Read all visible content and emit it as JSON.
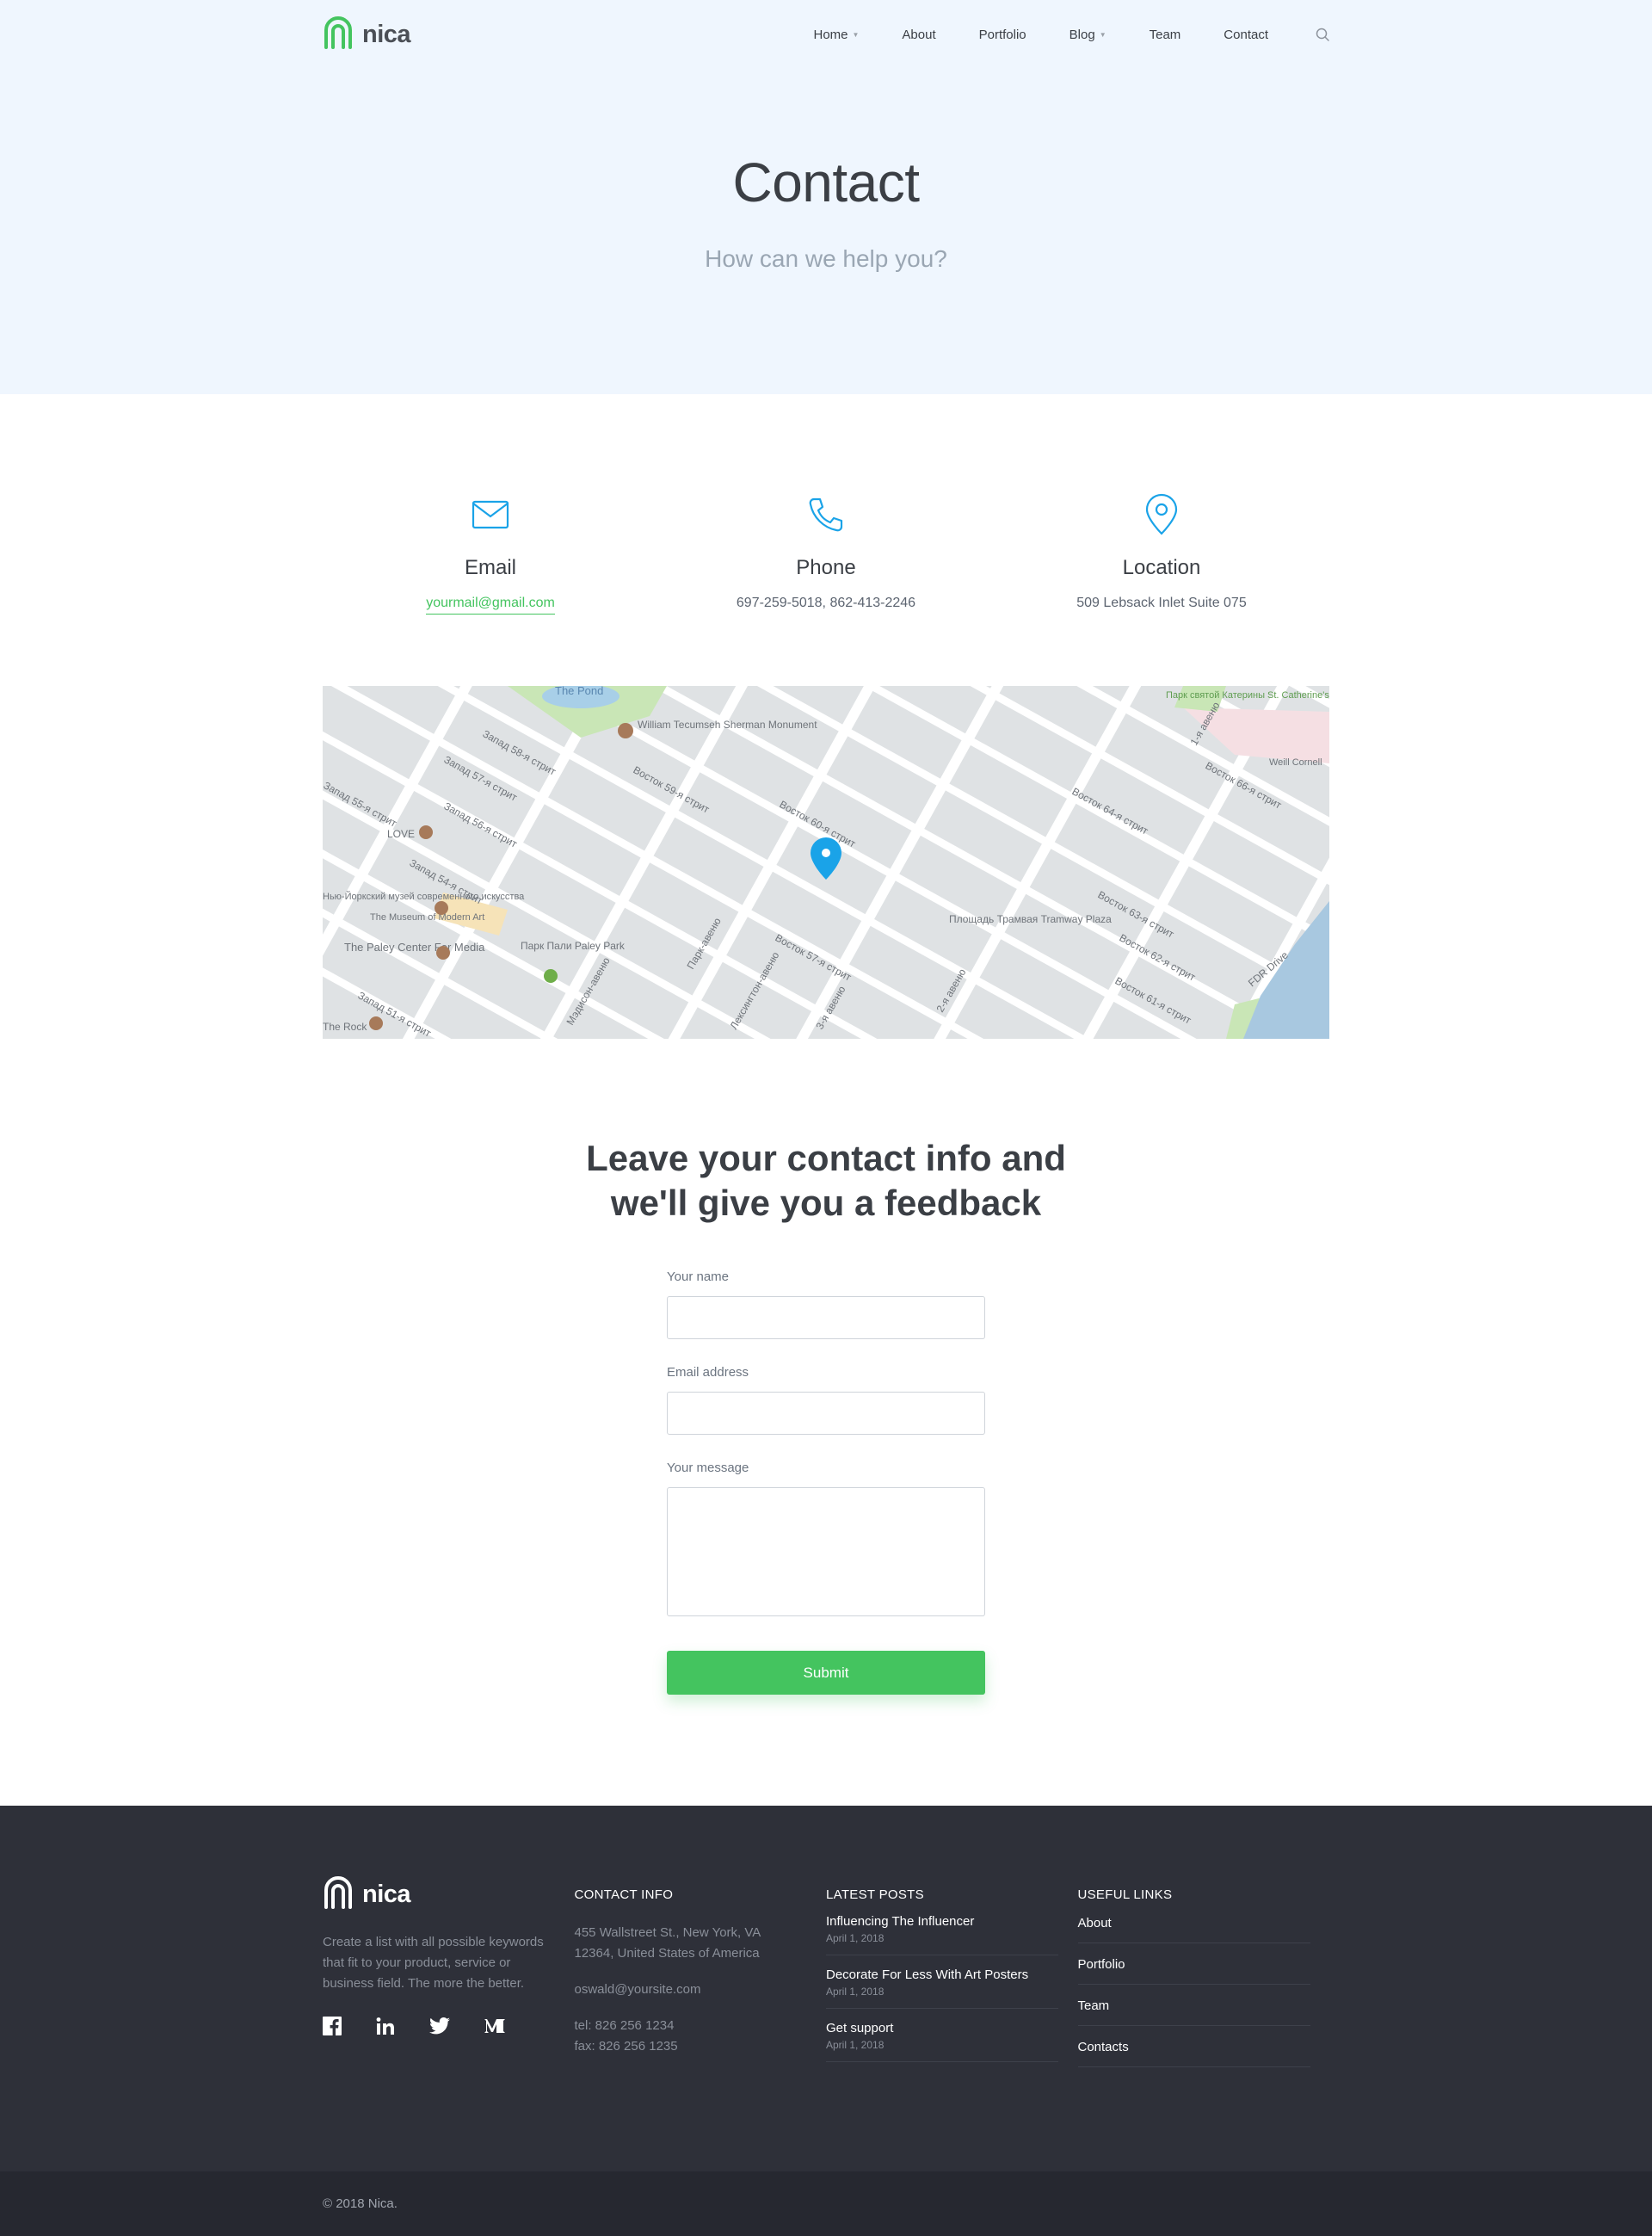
{
  "brand": {
    "name": "nica",
    "accent": "#44c45f",
    "icon_color": "#1aa3e8"
  },
  "nav": {
    "items": [
      {
        "label": "Home",
        "dropdown": true
      },
      {
        "label": "About",
        "dropdown": false
      },
      {
        "label": "Portfolio",
        "dropdown": false
      },
      {
        "label": "Blog",
        "dropdown": true
      },
      {
        "label": "Team",
        "dropdown": false
      },
      {
        "label": "Contact",
        "dropdown": false
      }
    ],
    "search_icon": "search-icon"
  },
  "hero": {
    "title": "Contact",
    "subtitle": "How can we help you?"
  },
  "contact_info": [
    {
      "icon": "mail-icon",
      "title": "Email",
      "value": "yourmail@gmail.com"
    },
    {
      "icon": "phone-icon",
      "title": "Phone",
      "value": "697-259-5018, 862-413-2246"
    },
    {
      "icon": "location-pin-icon",
      "title": "Location",
      "value": "509 Lebsack Inlet Suite 075"
    }
  ],
  "map": {
    "labels": [
      "The Pond",
      "William Tecumseh Sherman Monument",
      "Запад 58-я стрит",
      "Запад 57-я стрит",
      "Запад 56-я стрит",
      "Запад 55-я стрит",
      "Запад 54-я стрит",
      "Запад 51-я стрит",
      "LOVE",
      "Нью-Йоркский музей современного искусства",
      "The Museum of Modern Art",
      "The Paley Center For Media",
      "Парк Пали Paley Park",
      "Восток 59-я стрит",
      "Восток 60-я стрит",
      "Восток 57-я стрит",
      "Восток 64-я стрит",
      "Восток 63-я стрит",
      "Восток 62-я стрит",
      "Восток 61-я стрит",
      "Восток 66-я стрит",
      "Парк святой Катерины St. Catherine's Park",
      "Weill Cornell",
      "Площадь Трамвая Tramway Plaza",
      "FDR Drive",
      "Мэдисон-авеню",
      "Парк-авеню",
      "Лексингтон-авеню",
      "3-я авеню",
      "2-я авеню",
      "1-я авеню",
      "The Rock"
    ]
  },
  "form": {
    "title_line1": "Leave your contact info and",
    "title_line2": "we'll give you a feedback",
    "name_label": "Your name",
    "name_value": "",
    "email_label": "Email address",
    "email_value": "",
    "message_label": "Your message",
    "message_value": "",
    "submit_label": "Submit"
  },
  "footer": {
    "about_text": "Create a list with all possible keywords that fit to your product, service or business field. The more the better.",
    "socials": [
      "facebook-icon",
      "linkedin-icon",
      "twitter-icon",
      "medium-icon"
    ],
    "contact_heading": "CONTACT INFO",
    "address": "455 Wallstreet St., New York, VA 12364, United States of America",
    "email": "oswald@yoursite.com",
    "tel": "tel: 826 256 1234",
    "fax": "fax: 826 256 1235",
    "posts_heading": "LATEST POSTS",
    "posts": [
      {
        "title": "Influencing The Influencer",
        "date": "April 1, 2018"
      },
      {
        "title": "Decorate For Less With Art Posters",
        "date": "April 1, 2018"
      },
      {
        "title": "Get support",
        "date": "April 1, 2018"
      }
    ],
    "links_heading": "USEFUL LINKS",
    "links": [
      "About",
      "Portfolio",
      "Team",
      "Contacts"
    ],
    "copyright": "© 2018 Nica."
  }
}
